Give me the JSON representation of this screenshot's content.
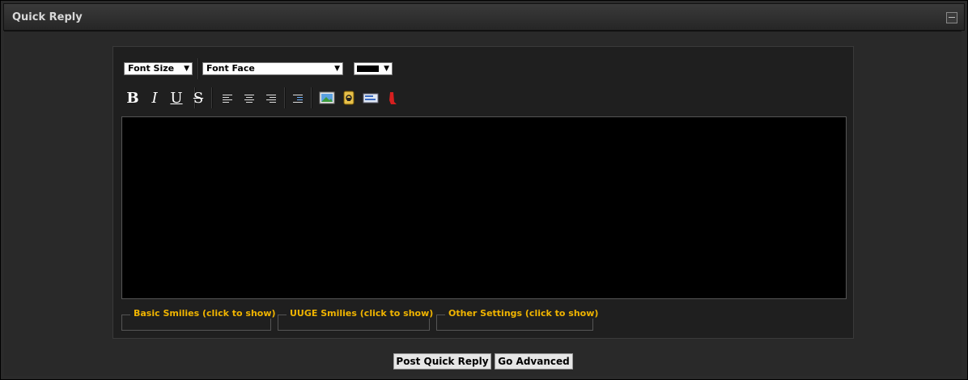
{
  "header": {
    "title": "Quick Reply"
  },
  "toolbar": {
    "font_size_label": "Font Size",
    "font_face_label": "Font Face",
    "dropdown_arrow": "▼",
    "selected_color": "#000000",
    "bold": "B",
    "italic": "I",
    "underline": "U",
    "strike": "S",
    "icons": [
      "align-left-icon",
      "align-center-icon",
      "align-right-icon",
      "indent-icon",
      "insert-image-icon",
      "lock-icon",
      "insert-email-icon",
      "bookmark-icon"
    ]
  },
  "editor": {
    "value": ""
  },
  "fieldsets": {
    "basic_smilies": "Basic Smilies (click to show)",
    "uuge_smilies": "UUGE Smilies (click to show)",
    "other_settings": "Other Settings (click to show)"
  },
  "buttons": {
    "post": "Post Quick Reply",
    "advanced": "Go Advanced"
  },
  "colors": {
    "legend": "#f0b400",
    "panel": "#1f1f1f",
    "background": "#292929"
  }
}
